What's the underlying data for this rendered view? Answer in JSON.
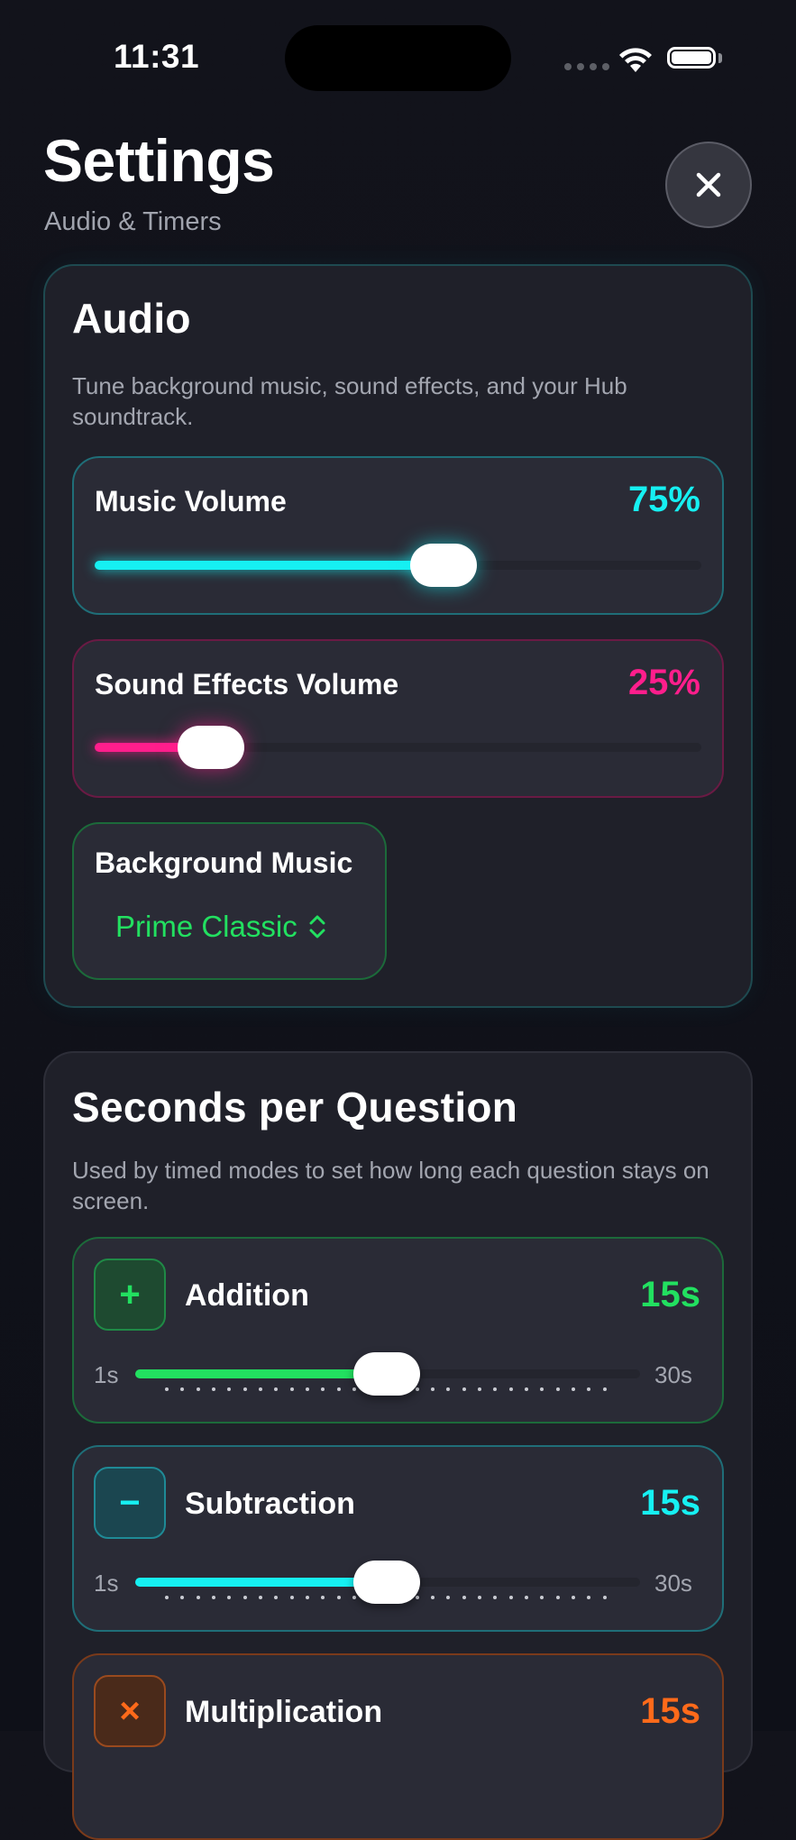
{
  "status_bar": {
    "time": "11:31"
  },
  "header": {
    "title": "Settings",
    "subtitle": "Audio & Timers"
  },
  "colors": {
    "cyan": "#16F0F2",
    "pink": "#FF1E8C",
    "green": "#22E060",
    "orange": "#FF6A1A"
  },
  "audio": {
    "title": "Audio",
    "description": "Tune background music, sound effects, and your Hub soundtrack.",
    "music": {
      "label": "Music Volume",
      "value": "75%",
      "level": 0.75
    },
    "sfx": {
      "label": "Sound Effects Volume",
      "value": "25%",
      "level": 0.25
    },
    "background": {
      "label": "Background Music",
      "selected": "Prime Classic"
    }
  },
  "seconds": {
    "title": "Seconds per Question",
    "description": "Used by timed modes to set how long each question stays on screen.",
    "min_label": "1s",
    "max_label": "30s",
    "items": [
      {
        "label": "Addition",
        "value": "15s",
        "seconds": 15,
        "icon": "plus-icon",
        "symbol": "+"
      },
      {
        "label": "Subtraction",
        "value": "15s",
        "seconds": 15,
        "icon": "minus-icon",
        "symbol": "−"
      },
      {
        "label": "Multiplication",
        "value": "15s",
        "seconds": 15,
        "icon": "times-icon",
        "symbol": "×"
      }
    ]
  }
}
